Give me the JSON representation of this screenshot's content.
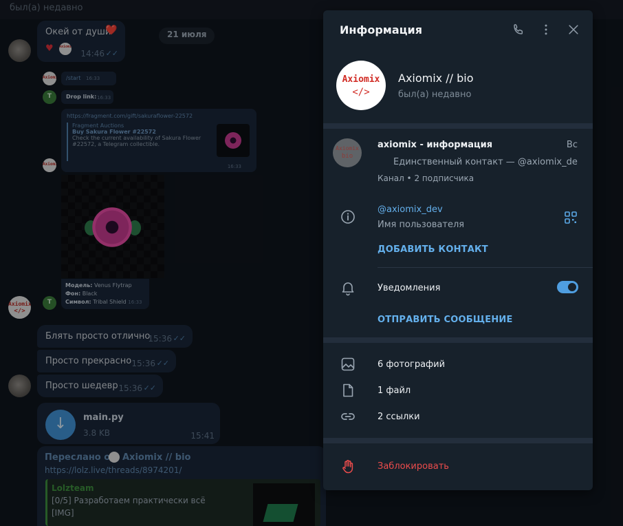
{
  "chat": {
    "header_status": "был(а) недавно",
    "date_pill": "21 июля",
    "messages": {
      "m1_text": "Окей от души",
      "m1_heart": "❤️",
      "m1_time": "14:46",
      "start_cmd": "/start",
      "start_time": "16:33",
      "drop_link": "Drop link:",
      "drop_time": "16:33",
      "preview_url": "https://fragment.com/gift/sakuraflower-22572",
      "preview_site": "Fragment Auctions",
      "preview_title": "Buy Sakura Flower #22572",
      "preview_desc1": "Check the current availability of Sakura Flower",
      "preview_desc2": "#22572, a Telegram collectible.",
      "preview_time": "16:33",
      "attr_model_label": "Модель:",
      "attr_model": "Venus Flytrap",
      "attr_bg_label": "Фон:",
      "attr_bg": "Black",
      "attr_symbol_label": "Символ:",
      "attr_symbol": "Tribal Shield",
      "attrs_time": "16:33",
      "m2_text": "Блять просто отлично",
      "m2_time": "15:36",
      "m3_text": "Просто прекрасно",
      "m3_time": "15:36",
      "m4_text": "Просто шедевр",
      "m4_time": "15:36",
      "file_name": "main.py",
      "file_size": "3.8 KB",
      "file_time": "15:41",
      "fwd_prefix": "Переслано от",
      "fwd_from": "Axiomix // bio",
      "fwd_link": "https://lolz.live/threads/8974201/",
      "lolz_title": "Lolzteam",
      "lolz_text": "[0/5] Разработаем практически всё",
      "lolz_img": "[IMG]"
    },
    "avatar_logo": "Axiomix",
    "avatar_code": "</>",
    "green_avatar_letter": "T"
  },
  "panel": {
    "title": "Информация",
    "icons": {
      "call": "phone-icon",
      "more": "more-vertical-icon",
      "close": "close-icon"
    },
    "profile": {
      "logo_text": "Axiomix",
      "logo_code": "</>",
      "name": "Axiomix // bio",
      "status": "был(а) недавно"
    },
    "channel": {
      "avatar_text": "Axiomix",
      "avatar_code": "bio",
      "name": "axiomix - информация",
      "day": "Вс",
      "preview": "Единственный контакт  — @axiomix_dev  ...",
      "meta": "Канал • 2 подписчика"
    },
    "username": "@axiomix_dev",
    "username_label": "Имя пользователя",
    "add_contact": "ДОБАВИТЬ КОНТАКТ",
    "notifications_label": "Уведомления",
    "notifications_on": true,
    "send_message": "ОТПРАВИТЬ СООБЩЕНИЕ",
    "media": {
      "photos": "6 фотографий",
      "files": "1 файл",
      "links": "2 ссылки"
    },
    "block": "Заблокировать",
    "colors": {
      "accent": "#64b0ec",
      "danger": "#ec4c4c",
      "panel_bg": "#17212b"
    }
  }
}
